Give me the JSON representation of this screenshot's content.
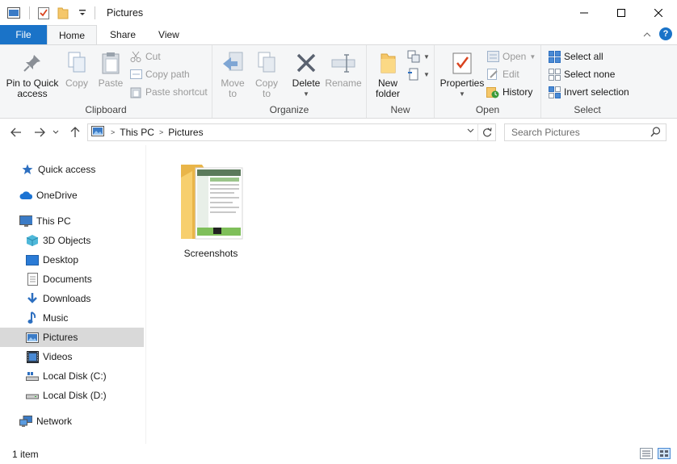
{
  "window": {
    "title": "Pictures"
  },
  "ribbon_tabs": [
    "File",
    "Home",
    "Share",
    "View"
  ],
  "ribbon": {
    "clipboard": {
      "label": "Clipboard",
      "pin": "Pin to Quick access",
      "copy": "Copy",
      "paste": "Paste",
      "cut": "Cut",
      "copy_path": "Copy path",
      "paste_shortcut": "Paste shortcut"
    },
    "organize": {
      "label": "Organize",
      "move_to": "Move to",
      "copy_to": "Copy to",
      "delete": "Delete",
      "rename": "Rename"
    },
    "new": {
      "label": "New",
      "new_folder": "New folder"
    },
    "open": {
      "label": "Open",
      "properties": "Properties",
      "open": "Open",
      "edit": "Edit",
      "history": "History"
    },
    "select": {
      "label": "Select",
      "select_all": "Select all",
      "select_none": "Select none",
      "invert": "Invert selection"
    }
  },
  "address": {
    "crumbs": [
      "This PC",
      "Pictures"
    ]
  },
  "search": {
    "placeholder": "Search Pictures"
  },
  "nav": {
    "items": [
      {
        "label": "Quick access",
        "icon": "star-icon"
      },
      {
        "label": "OneDrive",
        "icon": "cloud-icon"
      },
      {
        "label": "This PC",
        "icon": "computer-icon"
      },
      {
        "label": "3D Objects",
        "icon": "cube-icon"
      },
      {
        "label": "Desktop",
        "icon": "desktop-icon"
      },
      {
        "label": "Documents",
        "icon": "document-icon"
      },
      {
        "label": "Downloads",
        "icon": "download-icon"
      },
      {
        "label": "Music",
        "icon": "music-icon"
      },
      {
        "label": "Pictures",
        "icon": "pictures-icon"
      },
      {
        "label": "Videos",
        "icon": "video-icon"
      },
      {
        "label": "Local Disk (C:)",
        "icon": "disk-icon"
      },
      {
        "label": "Local Disk (D:)",
        "icon": "disk-icon"
      },
      {
        "label": "Network",
        "icon": "network-icon"
      }
    ]
  },
  "content": {
    "items": [
      {
        "name": "Screenshots",
        "type": "folder"
      }
    ]
  },
  "status": {
    "count": "1 item"
  },
  "colors": {
    "accent": "#1a73c8",
    "selected_nav": "#d9d9d9",
    "folder": "#f5c76a"
  }
}
